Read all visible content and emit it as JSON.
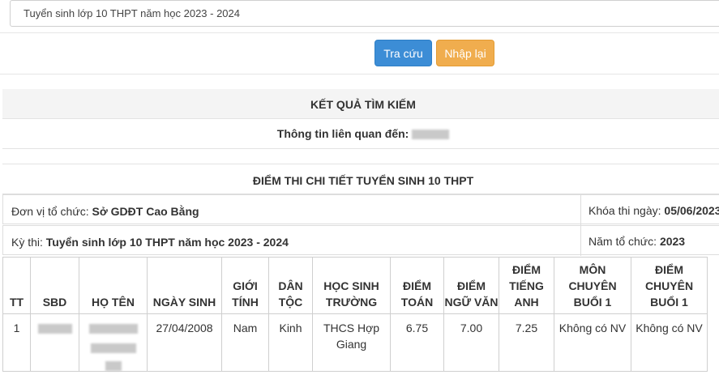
{
  "exam_select": {
    "value": "Tuyển sinh lớp 10 THPT năm học 2023 - 2024"
  },
  "buttons": {
    "search": "Tra cứu",
    "reset": "Nhập lại"
  },
  "result": {
    "title": "KẾT QUẢ TÌM KIẾM",
    "related_label": "Thông tin liên quan đến:"
  },
  "detail": {
    "title": "ĐIỂM THI CHI TIẾT TUYỂN SINH 10 THPT",
    "org_label": "Đơn vị tổ chức:",
    "org_value": "Sở GDĐT Cao Bằng",
    "date_label": "Khóa thi ngày:",
    "date_value": "05/06/2023",
    "exam_label": "Kỳ thi:",
    "exam_value": "Tuyển sinh lớp 10 THPT năm học 2023 - 2024",
    "year_label": "Năm tổ chức:",
    "year_value": "2023"
  },
  "table": {
    "headers": [
      "TT",
      "SBD",
      "HỌ TÊN",
      "NGÀY SINH",
      "GIỚI TÍNH",
      "DÂN TỘC",
      "HỌC SINH TRƯỜNG",
      "ĐIỂM TOÁN",
      "ĐIỂM NGỮ VĂN",
      "ĐIỂM TIẾNG ANH",
      "MÔN CHUYÊN BUỔI 1",
      "ĐIỂM CHUYÊN BUỔI 1"
    ],
    "rows": [
      {
        "tt": "1",
        "dob": "27/04/2008",
        "gender": "Nam",
        "ethnicity": "Kinh",
        "school": "THCS Hợp Giang",
        "math": "6.75",
        "literature": "7.00",
        "english": "7.25",
        "special_subject": "Không có NV",
        "special_score": "Không có NV"
      }
    ]
  },
  "colors": {
    "primary": "#3c8dd6",
    "warning": "#f0ad4e",
    "panel_bg": "#f4f4f4"
  }
}
